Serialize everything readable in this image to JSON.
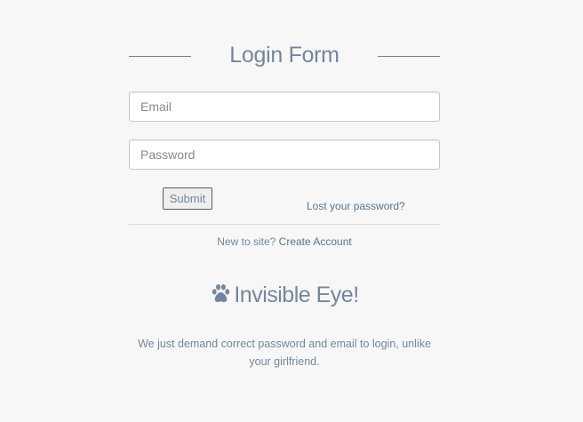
{
  "form": {
    "title": "Login Form",
    "email_placeholder": "Email",
    "password_placeholder": "Password",
    "submit_label": "Submit",
    "lost_password_label": "Lost your password?",
    "new_to_site_text": "New to site?",
    "create_account_label": "Create Account"
  },
  "brand": {
    "icon": "paw-icon",
    "name": "Invisible Eye!",
    "tagline": "We just demand correct password and email to login, unlike your girlfriend."
  },
  "colors": {
    "background": "#f7f7f7",
    "text": "#73879c",
    "link": "#5a738e"
  }
}
